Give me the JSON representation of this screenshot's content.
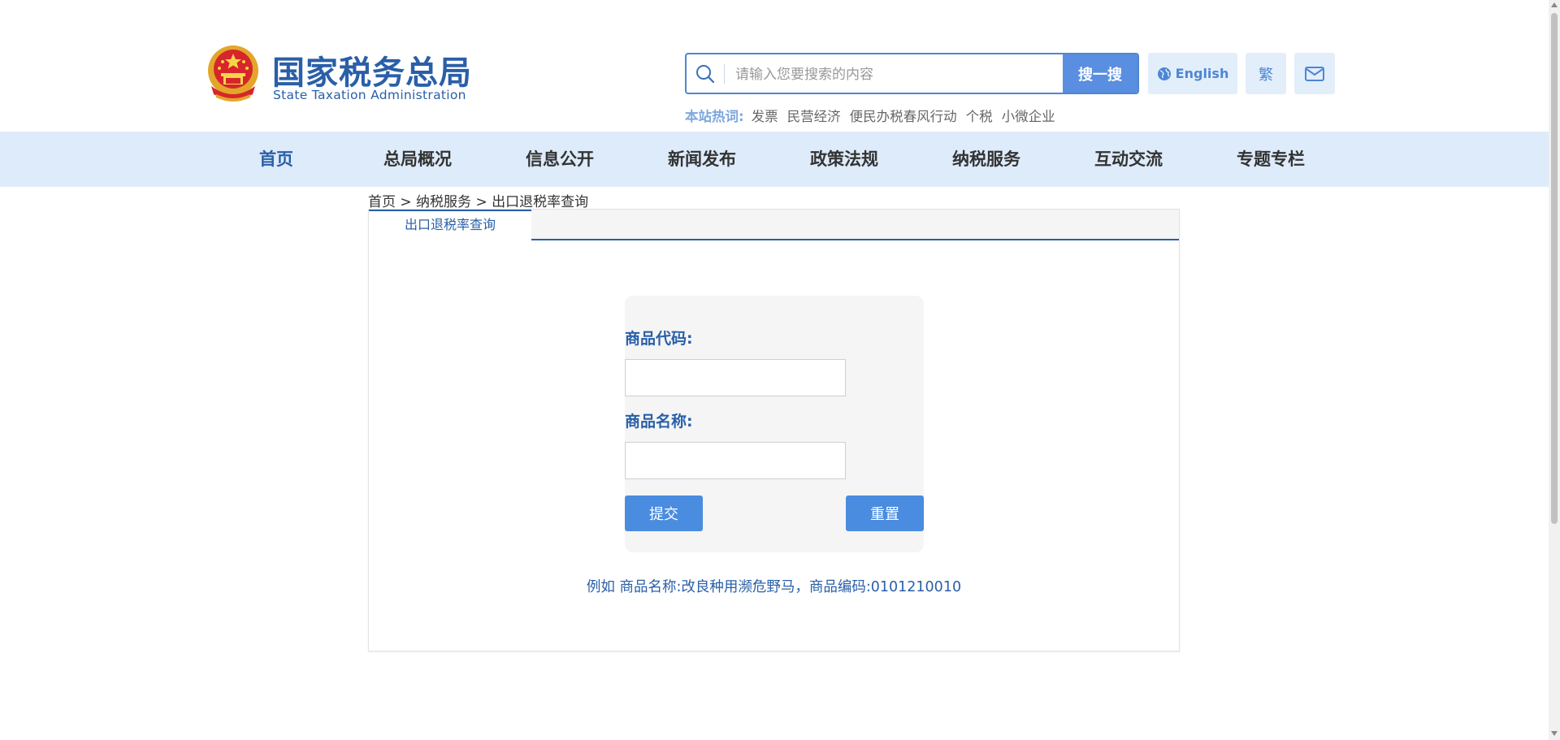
{
  "header": {
    "logo_cn": "国家税务总局",
    "logo_en": "State Taxation Administration",
    "search": {
      "placeholder": "请输入您要搜索的内容",
      "button": "搜一搜"
    },
    "english_label": "English",
    "traditional_label": "繁",
    "hot": {
      "label": "本站热词:",
      "items": [
        "发票",
        "民营经济",
        "便民办税春风行动",
        "个税",
        "小微企业"
      ]
    }
  },
  "nav": {
    "items": [
      {
        "label": "首页"
      },
      {
        "label": "总局概况"
      },
      {
        "label": "信息公开"
      },
      {
        "label": "新闻发布"
      },
      {
        "label": "政策法规"
      },
      {
        "label": "纳税服务"
      },
      {
        "label": "互动交流"
      },
      {
        "label": "专题专栏"
      }
    ]
  },
  "breadcrumb": "首页 >  纳税服务 > 出口退税率查询",
  "panel": {
    "tab": "出口退税率查询",
    "form": {
      "code_label": "商品代码:",
      "code_value": "",
      "name_label": "商品名称:",
      "name_value": "",
      "submit": "提交",
      "reset": "重置"
    },
    "example": "例如 商品名称:改良种用濒危野马，商品编码:0101210010"
  },
  "colors": {
    "brand": "#2a5fa8",
    "accent": "#4a8ce0",
    "nav_bg": "#deebfa"
  }
}
